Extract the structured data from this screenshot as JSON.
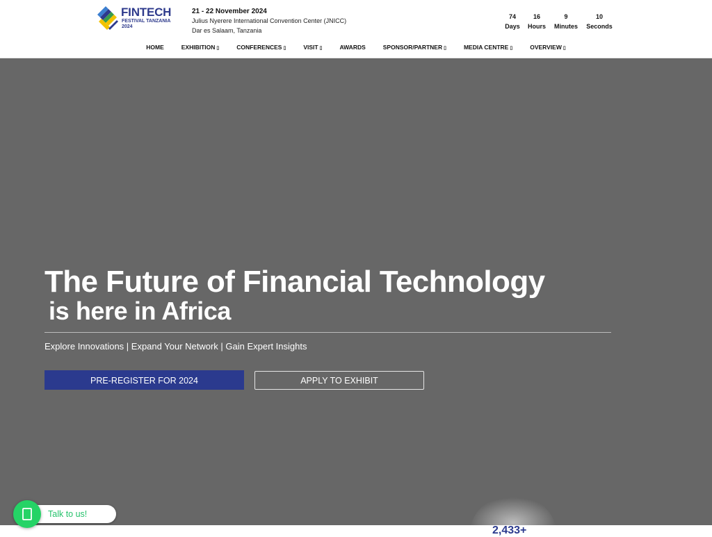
{
  "brand": {
    "name": "FINTECH",
    "subtitle": "FESTIVAL TANZANIA",
    "year": "2024",
    "colors": {
      "navy": "#2e3a8c",
      "yellow": "#f2c200",
      "green": "#3a9d4a",
      "blue": "#3c7fd0"
    }
  },
  "event": {
    "date": "21 - 22 November 2024",
    "venue": "Julius Nyerere International Convention Center (JNICC)",
    "city": "Dar es Salaam, Tanzania"
  },
  "countdown": [
    {
      "value": "74",
      "label": "Days"
    },
    {
      "value": "16",
      "label": "Hours"
    },
    {
      "value": "9",
      "label": "Minutes"
    },
    {
      "value": "10",
      "label": "Seconds"
    }
  ],
  "nav": {
    "items": [
      {
        "label": "HOME",
        "has_dropdown": false
      },
      {
        "label": "EXHIBITION",
        "has_dropdown": true
      },
      {
        "label": "CONFERENCES",
        "has_dropdown": true
      },
      {
        "label": "VISIT",
        "has_dropdown": true
      },
      {
        "label": "AWARDS",
        "has_dropdown": false
      },
      {
        "label": "SPONSOR/PARTNER",
        "has_dropdown": true
      },
      {
        "label": "MEDIA CENTRE",
        "has_dropdown": true
      },
      {
        "label": "OVERVIEW",
        "has_dropdown": true
      }
    ],
    "dropdown_glyph": "▯"
  },
  "hero": {
    "title_line1": "The Future of Financial Technology",
    "title_line2": "is here in Africa",
    "tagline": "Explore Innovations | Expand Your Network | Gain Expert Insights",
    "primary_button": "PRE-REGISTER FOR 2024",
    "secondary_button": "APPLY TO EXHIBIT",
    "background_color": "#676767",
    "button_color": "#2b3a8e"
  },
  "stats": {
    "count": "2,433+"
  },
  "chat": {
    "label": "Talk to us!",
    "icon": "whatsapp-icon",
    "color": "#25d366"
  }
}
